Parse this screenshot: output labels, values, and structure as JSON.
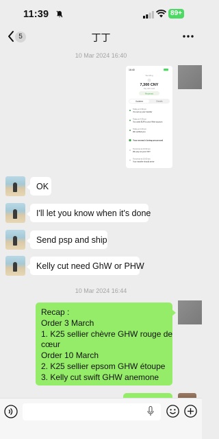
{
  "status_bar": {
    "time": "11:39",
    "battery": "89+"
  },
  "nav": {
    "unread_count": "5",
    "chat_title": "丁丁"
  },
  "messages": {
    "timestamp_1": "10 Mar 2024 16:40",
    "ok": "OK",
    "let_you_know": "I'll let you know when it's done",
    "send_psp": "Send psp and ship",
    "kelly_cut": "Kelly cut need GhW or PHW",
    "timestamp_2": "10 Mar 2024 16:44",
    "recap": {
      "line1": "Recap :",
      "line2": "Order 3 March",
      "line3": "1. K25 sellier chèvre GHW rouge de",
      "line4": "cœur",
      "line5": "Order 10 March",
      "line6": "2. K25 sellier epsom GHW étoupe",
      "line7": "3. Kelly cut swift GHW anemone"
    }
  },
  "screenshot_image": {
    "time": "16:40",
    "header": "Sending",
    "amount": "7,300 CNY",
    "subtitle": "Pay with Card",
    "status": "Received",
    "tab_updates": "Updates",
    "tab_details": "Details",
    "events": [
      {
        "time": "Today at 4:39 pm",
        "text": "You set up your transfer"
      },
      {
        "time": "Today at 4:39 pm",
        "text": "You used EUR to your Wise account"
      },
      {
        "time": "Today at 4:40 pm",
        "text": "We verified you"
      },
      {
        "time": "",
        "text": "Your money's being processed"
      },
      {
        "time": "Tomorrow at 10:00 am",
        "text": "We pay out your CNY"
      },
      {
        "time": "Tomorrow at 10:00 am",
        "text": "Your transfer should arrive"
      }
    ]
  },
  "colors": {
    "background": "#ededed",
    "sent_bubble": "#95ec69",
    "received_bubble": "#ffffff",
    "battery": "#4cd964"
  },
  "icons": {
    "bell": "bell-slash-icon",
    "back": "chevron-left-icon",
    "more": "ellipsis-icon",
    "voice": "voice-icon",
    "mic": "microphone-icon",
    "emoji": "emoji-icon",
    "plus": "plus-icon"
  }
}
